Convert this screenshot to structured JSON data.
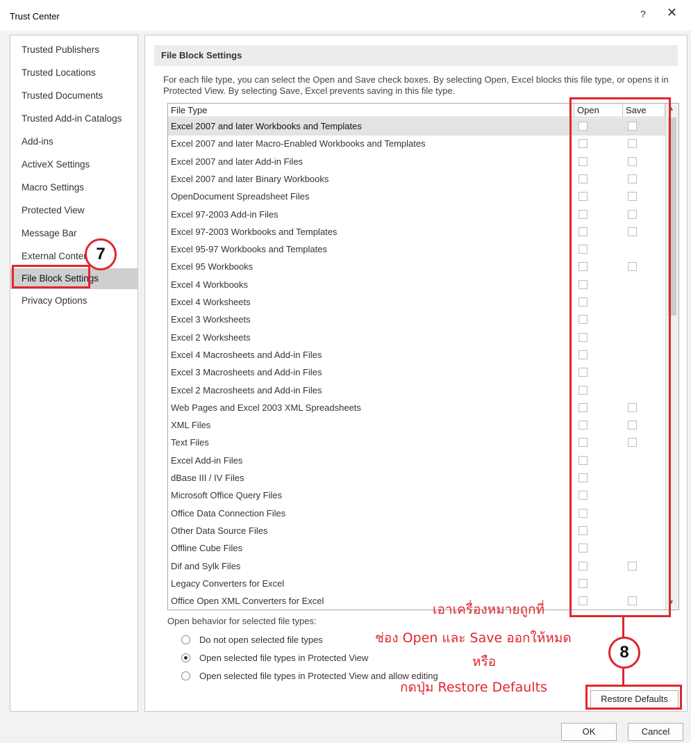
{
  "window": {
    "title": "Trust Center",
    "help_label": "?",
    "close_label": "✕"
  },
  "sidebar": {
    "items": [
      {
        "label": "Trusted Publishers"
      },
      {
        "label": "Trusted Locations"
      },
      {
        "label": "Trusted Documents"
      },
      {
        "label": "Trusted Add-in Catalogs"
      },
      {
        "label": "Add-ins"
      },
      {
        "label": "ActiveX Settings"
      },
      {
        "label": "Macro Settings"
      },
      {
        "label": "Protected View"
      },
      {
        "label": "Message Bar"
      },
      {
        "label": "External Content"
      },
      {
        "label": "File Block Settings",
        "selected": true
      },
      {
        "label": "Privacy Options"
      }
    ]
  },
  "main": {
    "section_title": "File Block Settings",
    "description": "For each file type, you can select the Open and Save check boxes. By selecting Open, Excel blocks this file type, or opens it in Protected View. By selecting Save, Excel prevents saving in this file type.",
    "table": {
      "headers": {
        "file_type": "File Type",
        "open": "Open",
        "save": "Save"
      },
      "rows": [
        {
          "label": "Excel 2007 and later Workbooks and Templates",
          "open": false,
          "save": false
        },
        {
          "label": "Excel 2007 and later Macro-Enabled Workbooks and Templates",
          "open": false,
          "save": false
        },
        {
          "label": "Excel 2007 and later Add-in Files",
          "open": false,
          "save": false
        },
        {
          "label": "Excel 2007 and later Binary Workbooks",
          "open": false,
          "save": false
        },
        {
          "label": "OpenDocument Spreadsheet Files",
          "open": false,
          "save": false
        },
        {
          "label": "Excel 97-2003 Add-in Files",
          "open": false,
          "save": false
        },
        {
          "label": "Excel 97-2003 Workbooks and Templates",
          "open": false,
          "save": false
        },
        {
          "label": "Excel 95-97 Workbooks and Templates",
          "open": false,
          "save": null
        },
        {
          "label": "Excel 95 Workbooks",
          "open": false,
          "save": false
        },
        {
          "label": "Excel 4 Workbooks",
          "open": false,
          "save": null
        },
        {
          "label": "Excel 4 Worksheets",
          "open": false,
          "save": null
        },
        {
          "label": "Excel 3 Worksheets",
          "open": false,
          "save": null
        },
        {
          "label": "Excel 2 Worksheets",
          "open": false,
          "save": null
        },
        {
          "label": "Excel 4 Macrosheets and Add-in Files",
          "open": false,
          "save": null
        },
        {
          "label": "Excel 3 Macrosheets and Add-in Files",
          "open": false,
          "save": null
        },
        {
          "label": "Excel 2 Macrosheets and Add-in Files",
          "open": false,
          "save": null
        },
        {
          "label": "Web Pages and Excel 2003 XML Spreadsheets",
          "open": false,
          "save": false
        },
        {
          "label": "XML Files",
          "open": false,
          "save": false
        },
        {
          "label": "Text Files",
          "open": false,
          "save": false
        },
        {
          "label": "Excel Add-in Files",
          "open": false,
          "save": null
        },
        {
          "label": "dBase III / IV Files",
          "open": false,
          "save": null
        },
        {
          "label": "Microsoft Office Query Files",
          "open": false,
          "save": null
        },
        {
          "label": "Office Data Connection Files",
          "open": false,
          "save": null
        },
        {
          "label": "Other Data Source Files",
          "open": false,
          "save": null
        },
        {
          "label": "Offline Cube Files",
          "open": false,
          "save": null
        },
        {
          "label": "Dif and Sylk Files",
          "open": false,
          "save": false
        },
        {
          "label": "Legacy Converters for Excel",
          "open": false,
          "save": null
        },
        {
          "label": "Office Open XML Converters for Excel",
          "open": false,
          "save": false
        }
      ]
    },
    "open_behavior": {
      "label": "Open behavior for selected file types:",
      "options": [
        {
          "label": "Do not open selected file types",
          "checked": false
        },
        {
          "label": "Open selected file types in Protected View",
          "checked": true
        },
        {
          "label": "Open selected file types in Protected View and allow editing",
          "checked": false
        }
      ]
    },
    "restore_defaults_label": "Restore Defaults"
  },
  "footer": {
    "ok_label": "OK",
    "cancel_label": "Cancel"
  },
  "annotations": {
    "step7": "7",
    "step8": "8",
    "instruction_line1": "เอาเครื่องหมายถูกที่",
    "instruction_line2": "ช่อง Open และ Save ออกให้หมด",
    "instruction_line3": "หรือ",
    "instruction_line4": "กดปุ่ม Restore Defaults",
    "color": "#e0262e"
  }
}
